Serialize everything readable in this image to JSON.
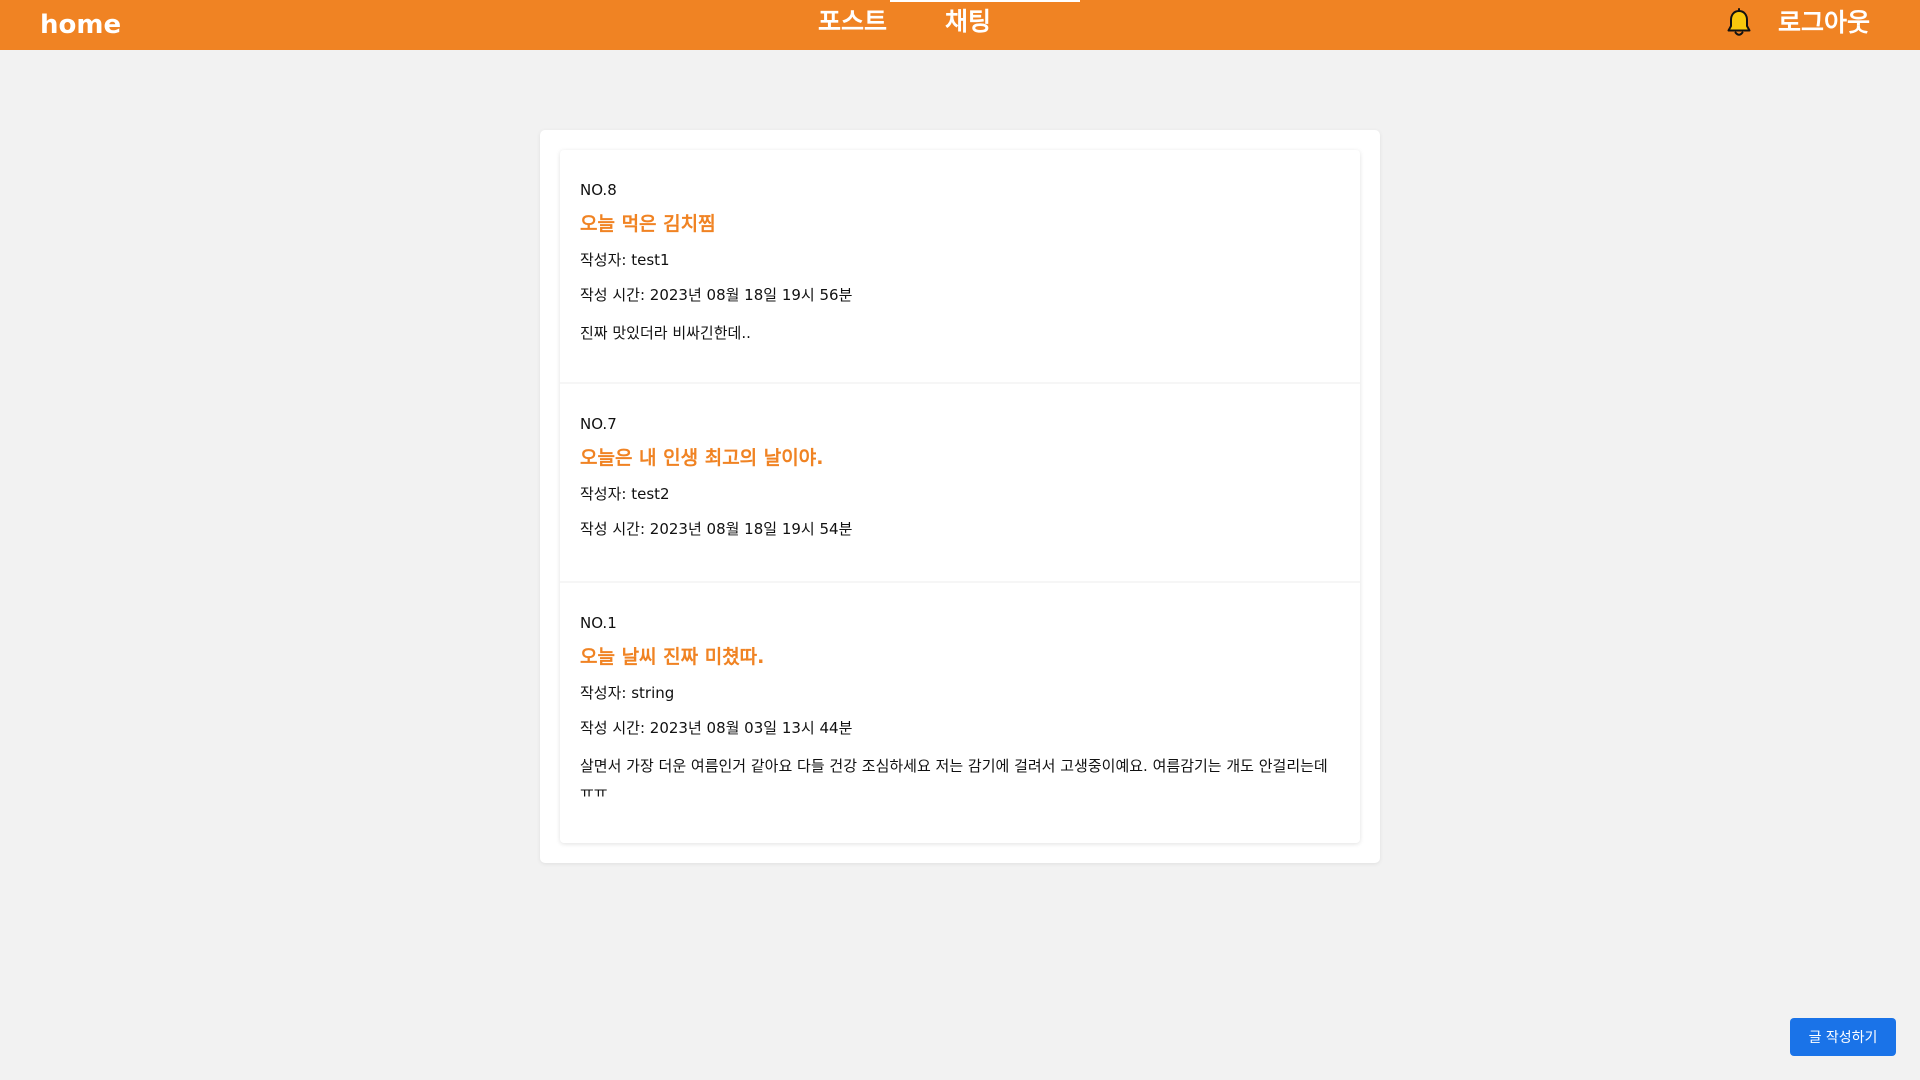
{
  "nav": {
    "home": "home",
    "links": [
      "포스트",
      "채팅"
    ],
    "logout": "로그아웃",
    "bell_icon": "bell-icon"
  },
  "posts": [
    {
      "no": "NO.8",
      "title": "오늘 먹은 김치찜",
      "author": "작성자: test1",
      "time": "작성 시간: 2023년 08월 18일 19시 56분",
      "body": "진짜 맛있더라 비싸긴한데.."
    },
    {
      "no": "NO.7",
      "title": "오늘은 내 인생 최고의 날이야.",
      "author": "작성자: test2",
      "time": "작성 시간: 2023년 08월 18일 19시 54분",
      "body": ""
    },
    {
      "no": "NO.1",
      "title": "오늘 날씨 진짜 미쳤따.",
      "author": "작성자: string",
      "time": "작성 시간: 2023년 08월 03일 13시 44분",
      "body": "살면서 가장 더운 여름인거 같아요 다들 건강 조심하세요 저는 감기에 걸려서 고생중이예요. 여름감기는 개도 안걸리는데 ㅠㅠ"
    }
  ],
  "write_button": "글 작성하기",
  "colors": {
    "accent": "#f08323",
    "background": "#f2f2f2",
    "button": "#1a73e8"
  }
}
